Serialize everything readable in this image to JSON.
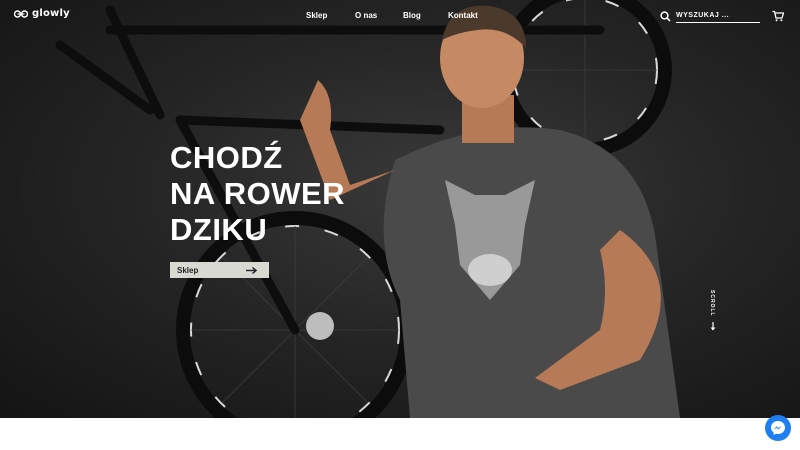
{
  "brand": {
    "name": "glowly"
  },
  "nav": {
    "items": [
      "Sklep",
      "O nas",
      "Blog",
      "Kontakt"
    ]
  },
  "search": {
    "placeholder": "WYSZUKAJ ..."
  },
  "hero": {
    "lines": [
      "CHODŹ",
      "NA ROWER",
      "DZIKU"
    ],
    "cta_label": "Sklep",
    "scroll_label": "SCROLL"
  },
  "icons": {
    "logo": "bike-logo-icon",
    "search": "search-icon",
    "cart": "cart-icon",
    "cta": "arrow-right-icon",
    "scroll": "arrow-down-icon",
    "chat": "messenger-icon"
  },
  "colors": {
    "hero_bg": "#262626",
    "button_bg": "#d9d9d4",
    "chat": "#1d7ff2",
    "text": "#ffffff"
  }
}
